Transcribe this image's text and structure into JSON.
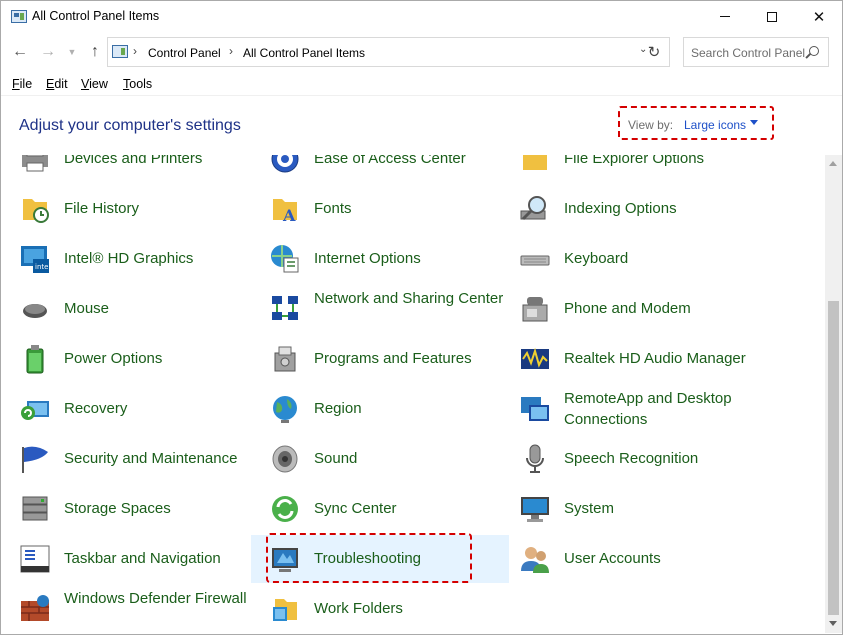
{
  "window": {
    "title": "All Control Panel Items"
  },
  "address": {
    "crumbs": [
      "Control Panel",
      "All Control Panel Items"
    ],
    "search_placeholder": "Search Control Panel"
  },
  "menu": {
    "items": [
      {
        "label": "File",
        "accel": "F",
        "rest": "ile"
      },
      {
        "label": "Edit",
        "accel": "E",
        "rest": "dit"
      },
      {
        "label": "View",
        "accel": "V",
        "rest": "iew"
      },
      {
        "label": "Tools",
        "accel": "T",
        "rest": "ools"
      }
    ]
  },
  "header": {
    "title": "Adjust your computer's settings",
    "view_by_label": "View by:",
    "view_by_value": "Large icons"
  },
  "columns": [
    [
      {
        "label": "Devices and Printers",
        "icon": "printer-icon"
      },
      {
        "label": "File History",
        "icon": "file-history-icon"
      },
      {
        "label": "Intel® HD Graphics",
        "icon": "intel-graphics-icon"
      },
      {
        "label": "Mouse",
        "icon": "mouse-icon"
      },
      {
        "label": "Power Options",
        "icon": "battery-icon"
      },
      {
        "label": "Recovery",
        "icon": "recovery-icon"
      },
      {
        "label": "Security and Maintenance",
        "icon": "flag-icon"
      },
      {
        "label": "Storage Spaces",
        "icon": "storage-icon"
      },
      {
        "label": "Taskbar and Navigation",
        "icon": "taskbar-icon"
      },
      {
        "label": "Windows Defender Firewall",
        "icon": "firewall-icon"
      }
    ],
    [
      {
        "label": "Ease of Access Center",
        "icon": "ease-of-access-icon"
      },
      {
        "label": "Fonts",
        "icon": "fonts-icon"
      },
      {
        "label": "Internet Options",
        "icon": "internet-options-icon"
      },
      {
        "label": "Network and Sharing Center",
        "icon": "network-icon"
      },
      {
        "label": "Programs and Features",
        "icon": "programs-icon"
      },
      {
        "label": "Region",
        "icon": "globe-icon"
      },
      {
        "label": "Sound",
        "icon": "speaker-icon"
      },
      {
        "label": "Sync Center",
        "icon": "sync-icon"
      },
      {
        "label": "Troubleshooting",
        "icon": "troubleshooting-icon"
      },
      {
        "label": "Work Folders",
        "icon": "work-folders-icon"
      }
    ],
    [
      {
        "label": "File Explorer Options",
        "icon": "folder-options-icon"
      },
      {
        "label": "Indexing Options",
        "icon": "indexing-icon"
      },
      {
        "label": "Keyboard",
        "icon": "keyboard-icon"
      },
      {
        "label": "Phone and Modem",
        "icon": "phone-icon"
      },
      {
        "label": "Realtek HD Audio Manager",
        "icon": "audio-manager-icon"
      },
      {
        "label": "RemoteApp and Desktop Connections",
        "icon": "remoteapp-icon"
      },
      {
        "label": "Speech Recognition",
        "icon": "microphone-icon"
      },
      {
        "label": "System",
        "icon": "monitor-icon"
      },
      {
        "label": "User Accounts",
        "icon": "users-icon"
      }
    ]
  ],
  "colors": {
    "link_green": "#1a5e1a",
    "heading_blue": "#1e3287",
    "highlight_bg": "#e5f3ff",
    "annotation_red": "#d40000"
  }
}
